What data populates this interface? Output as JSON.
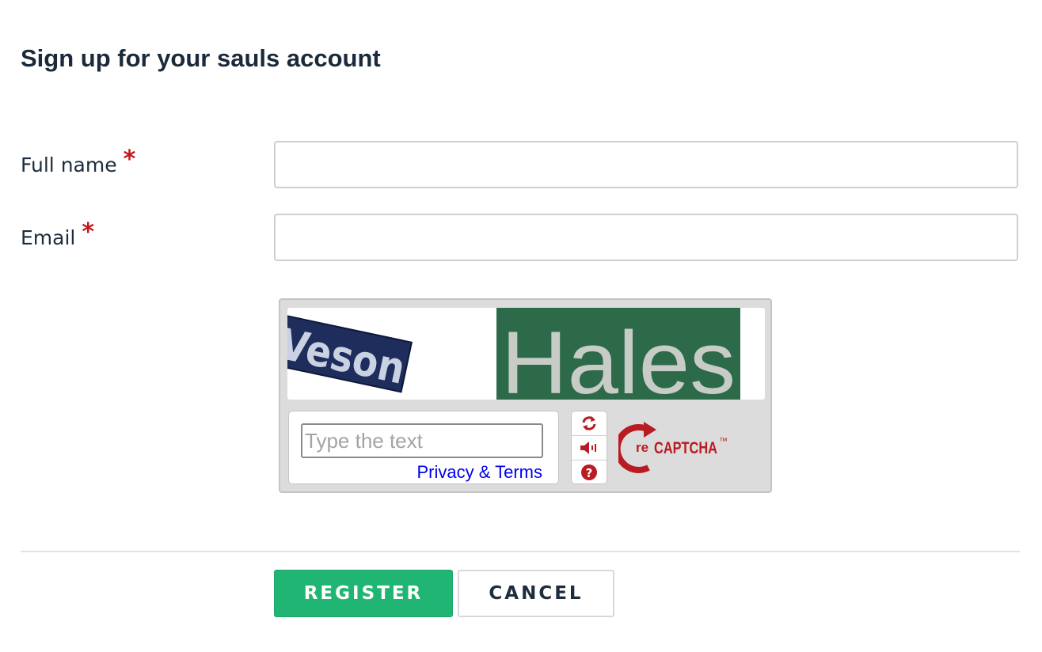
{
  "form": {
    "title": "Sign up for your sauls account",
    "required_marker": "*",
    "fields": [
      {
        "label": "Full name",
        "value": "",
        "placeholder": ""
      },
      {
        "label": "Email",
        "value": "",
        "placeholder": ""
      }
    ]
  },
  "captcha": {
    "words": [
      "Veson",
      "Hales"
    ],
    "input_placeholder": "Type the text",
    "input_value": "",
    "privacy_link": "Privacy & Terms",
    "controls": [
      "refresh-icon",
      "audio-icon",
      "help-icon"
    ],
    "logo_text_re": "re",
    "logo_text_main": "CAPTCHA",
    "logo_tm": "™",
    "brand_color": "#b81c22"
  },
  "actions": {
    "register_label": "REGISTER",
    "cancel_label": "CANCEL",
    "register_color": "#20b573"
  }
}
